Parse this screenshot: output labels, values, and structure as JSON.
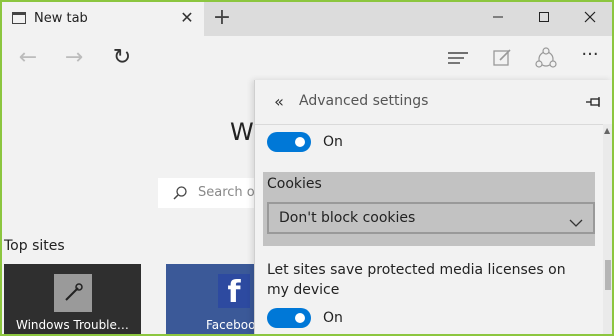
{
  "browser": {
    "tab_title": "New tab",
    "close_tab": "✕",
    "new_tab": "+",
    "window_controls": {
      "minimize": "—",
      "maximize": "☐",
      "close": "✕"
    }
  },
  "navbar": {
    "back": "←",
    "forward": "→",
    "refresh": "↻",
    "more": "···"
  },
  "page": {
    "heading_partial": "W",
    "search_placeholder": "Search or",
    "top_sites_label": "Top sites",
    "tiles": [
      {
        "label": "Windows Trouble…",
        "icon": "wrench-icon"
      },
      {
        "label": "Facebook",
        "icon": "facebook-icon",
        "glyph": "f"
      }
    ]
  },
  "settings": {
    "back_icon": "«",
    "title": "Advanced settings",
    "toggle1": {
      "state": "On"
    },
    "cookies": {
      "label": "Cookies",
      "selected": "Don't block cookies"
    },
    "media_licenses": {
      "text": "Let sites save protected media licenses on my device",
      "state": "On"
    }
  },
  "colors": {
    "accent": "#0078d7",
    "window_border": "#8cc63f",
    "cookies_bg": "#c2c2c2"
  }
}
